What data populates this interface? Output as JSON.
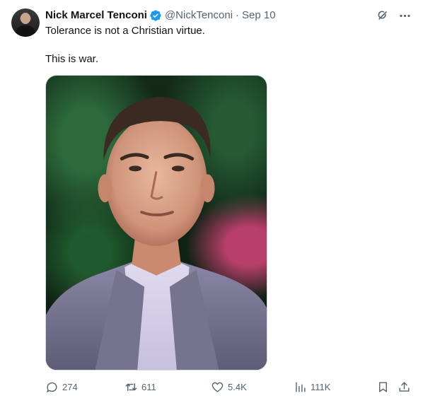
{
  "author": {
    "display_name": "Nick Marcel Tenconi",
    "handle": "@NickTenconi",
    "separator": "·",
    "date": "Sep 10",
    "verified": true,
    "verified_color": "#1d9bf0"
  },
  "tweet": {
    "lines": [
      "Tolerance is not a Christian virtue.",
      "This is war."
    ]
  },
  "actions": {
    "replies": "274",
    "reposts": "611",
    "likes": "5.4K",
    "views": "111K"
  },
  "icons": {
    "grok": "grok-icon",
    "more": "more-icon",
    "reply": "reply-icon",
    "repost": "repost-icon",
    "like": "heart-icon",
    "views": "views-icon",
    "bookmark": "bookmark-icon",
    "share": "share-icon"
  },
  "colors": {
    "text": "#0f1419",
    "muted": "#536471",
    "accent": "#1d9bf0",
    "border": "#cfd9de"
  }
}
